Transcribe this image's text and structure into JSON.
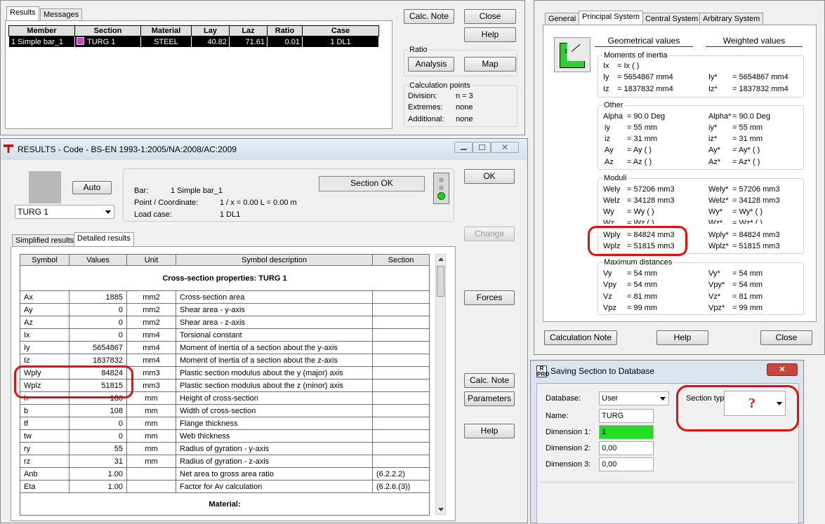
{
  "top": {
    "tabs": [
      "Results",
      "Messages"
    ],
    "headers": [
      "Member",
      "Section",
      "Material",
      "Lay",
      "Laz",
      "Ratio",
      "Case"
    ],
    "row": {
      "member": "1 Simple bar_1",
      "section": "TURG 1",
      "material": "STEEL",
      "lay": "40.82",
      "laz": "71.61",
      "ratio": "0.01",
      "case": "1 DL1"
    },
    "calc_note": "Calc. Note",
    "close": "Close",
    "help": "Help",
    "ratio_title": "Ratio",
    "analysis": "Analysis",
    "map": "Map",
    "cp_title": "Calculation points",
    "cp_rows": [
      {
        "label": "Division:",
        "value": "n = 3"
      },
      {
        "label": "Extremes:",
        "value": "none"
      },
      {
        "label": "Additional:",
        "value": "none"
      }
    ]
  },
  "results": {
    "title": "RESULTS - Code - BS-EN 1993-1:2005/NA:2008/AC:2009",
    "auto": "Auto",
    "section_select": "TURG 1",
    "bar_label": "Bar:",
    "bar_value": "1  Simple bar_1",
    "point_label": "Point / Coordinate:",
    "point_value": "1 / x = 0.00 L = 0.00 m",
    "load_label": "Load case:",
    "load_value": "1 DL1",
    "status": "Section OK",
    "tabs": [
      "Simplified results",
      "Detailed results"
    ],
    "headers": [
      "Symbol",
      "Values",
      "Unit",
      "Symbol description",
      "Section"
    ],
    "group_title": "Cross-section properties: TURG 1",
    "rows": [
      {
        "s": "Ax",
        "v": "1885",
        "u": "mm2",
        "d": "Cross-section area",
        "sec": ""
      },
      {
        "s": "Ay",
        "v": "0",
        "u": "mm2",
        "d": "Shear area - y-axis",
        "sec": ""
      },
      {
        "s": "Az",
        "v": "0",
        "u": "mm2",
        "d": "Shear area - z-axis",
        "sec": ""
      },
      {
        "s": "Ix",
        "v": "0",
        "u": "mm4",
        "d": "Torsional constant",
        "sec": ""
      },
      {
        "s": "Iy",
        "v": "5654867",
        "u": "mm4",
        "d": "Moment of inertia of a section about the y-axis",
        "sec": ""
      },
      {
        "s": "Iz",
        "v": "1837832",
        "u": "mm4",
        "d": "Moment of inertia of a section about the z-axis",
        "sec": ""
      },
      {
        "s": "Wply",
        "v": "84824",
        "u": "mm3",
        "d": "Plastic section modulus about the y (major) axis",
        "sec": ""
      },
      {
        "s": "Wplz",
        "v": "51815",
        "u": "mm3",
        "d": "Plastic section modulus about the z (minor) axis",
        "sec": ""
      },
      {
        "s": "h",
        "v": "180",
        "u": "mm",
        "d": "Height of cross-section",
        "sec": ""
      },
      {
        "s": "b",
        "v": "108",
        "u": "mm",
        "d": "Width of cross-section",
        "sec": ""
      },
      {
        "s": "tf",
        "v": "0",
        "u": "mm",
        "d": "Flange thickness",
        "sec": ""
      },
      {
        "s": "tw",
        "v": "0",
        "u": "mm",
        "d": "Web thickness",
        "sec": ""
      },
      {
        "s": "ry",
        "v": "55",
        "u": "mm",
        "d": "Radius of gyration - y-axis",
        "sec": ""
      },
      {
        "s": "rz",
        "v": "31",
        "u": "mm",
        "d": "Radius of gyration - z-axis",
        "sec": ""
      },
      {
        "s": "Anb",
        "v": "1.00",
        "u": "",
        "d": "Net area to gross area ratio",
        "sec": "(6.2.2.2)"
      },
      {
        "s": "Eta",
        "v": "1.00",
        "u": "",
        "d": "Factor for Av calculation",
        "sec": "(6.2.6.(3))"
      }
    ],
    "material_title": "Material:",
    "ok": "OK",
    "change": "Change",
    "forces": "Forces",
    "calc_note": "Calc. Note",
    "parameters": "Parameters",
    "help": "Help"
  },
  "props": {
    "tabs": [
      "General",
      "Principal System",
      "Central System",
      "Arbitrary System"
    ],
    "geo": "Geometrical values",
    "weighted": "Weighted values",
    "groups": [
      {
        "title": "Moments of inertia",
        "rows": [
          [
            "Ix",
            "= Ix ( )",
            "",
            ""
          ],
          [
            "Iy",
            "= 5654867 mm4",
            "Iy*",
            "= 5654867 mm4"
          ],
          [
            "Iz",
            "= 1837832 mm4",
            "Iz*",
            "= 1837832 mm4"
          ]
        ]
      },
      {
        "title": "Other",
        "rows": [
          [
            "Alpha",
            "= 90.0 Deg",
            "Alpha*",
            "= 90.0 Deg"
          ],
          [
            "iy",
            "= 55 mm",
            "iy*",
            "= 55 mm"
          ],
          [
            "iz",
            "= 31 mm",
            "iz*",
            "= 31 mm"
          ],
          [
            "Ay",
            "= Ay ( )",
            "Ay*",
            "= Ay* ( )"
          ],
          [
            "Az",
            "= Az ( )",
            "Az*",
            "= Az* ( )"
          ]
        ]
      },
      {
        "title": "Moduli",
        "rows": [
          [
            "Wely",
            "= 57206 mm3",
            "Wely*",
            "= 57206 mm3"
          ],
          [
            "Welz",
            "= 34128 mm3",
            "Welz*",
            "= 34128 mm3"
          ],
          [
            "Wy",
            "= Wy ( )",
            "Wy*",
            "= Wy* ( )"
          ],
          [
            "Wz",
            "= Wz ( )",
            "Wz*",
            "= Wz* ( )"
          ],
          [
            "Wply",
            "= 84824 mm3",
            "Wply*",
            "= 84824 mm3"
          ],
          [
            "Wplz",
            "= 51815 mm3",
            "Wplz*",
            "= 51815 mm3"
          ]
        ]
      },
      {
        "title": "Maximum distances",
        "rows": [
          [
            "Vy",
            "= 54 mm",
            "Vy*",
            "= 54 mm"
          ],
          [
            "Vpy",
            "= 54 mm",
            "Vpy*",
            "= 54 mm"
          ],
          [
            "Vz",
            "= 81 mm",
            "Vz*",
            "= 81 mm"
          ],
          [
            "Vpz",
            "= 99 mm",
            "Vpz*",
            "= 99 mm"
          ]
        ]
      }
    ],
    "calc_note": "Calculation Note",
    "help": "Help",
    "close": "Close"
  },
  "save": {
    "title": "Saving Section to Database",
    "database_label": "Database:",
    "database_value": "User",
    "name_label": "Name:",
    "name_value": "TURG",
    "dim1_label": "Dimension 1:",
    "dim1_value": "1",
    "dim2_label": "Dimension 2:",
    "dim2_value": "0,00",
    "dim3_label": "Dimension 3:",
    "dim3_value": "0,00",
    "section_type_label": "Section typ",
    "question": "?",
    "colors": {
      "highlight_green": "#22dd22",
      "annotation_red": "#e01010"
    }
  }
}
